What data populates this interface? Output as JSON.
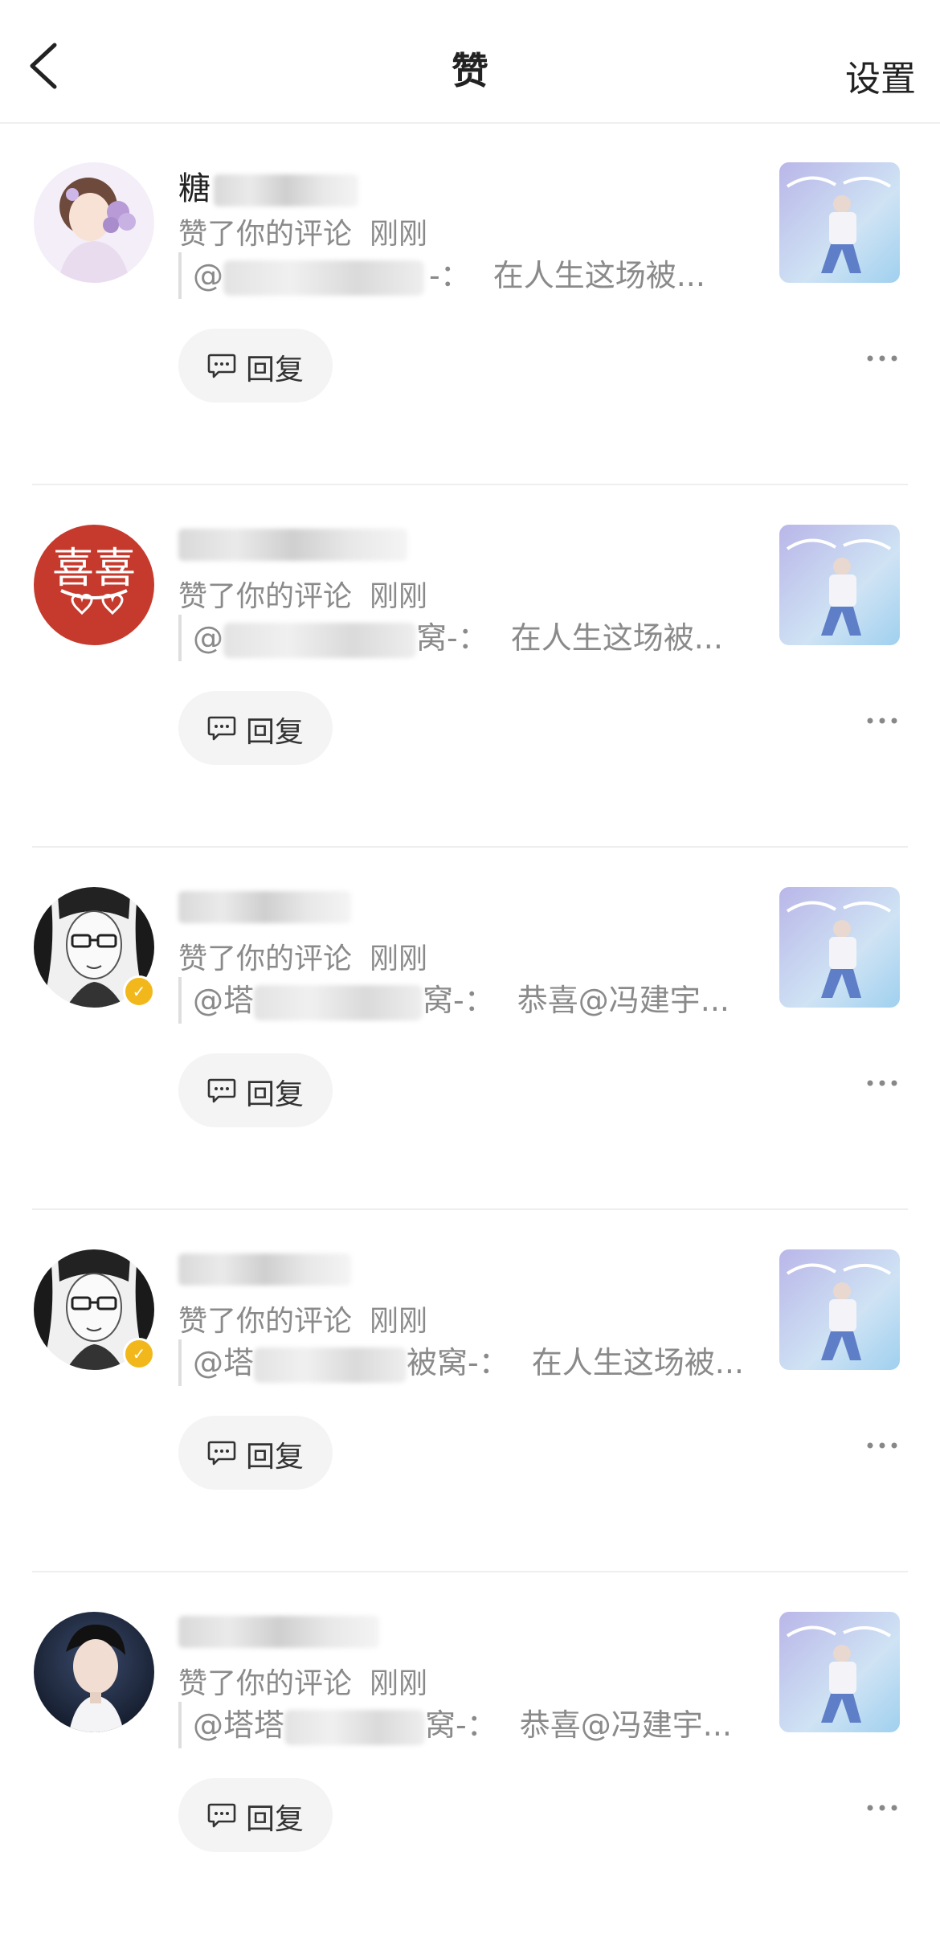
{
  "header": {
    "title": "赞",
    "settings_label": "设置"
  },
  "items": [
    {
      "name_visible": "糖",
      "action": "赞了你的评论",
      "time": "刚刚",
      "quote_prefix": "@",
      "quote_content": "在人生这场被...",
      "reply_label": "回复",
      "avatar": "girl-flowers-avatar",
      "verified": false
    },
    {
      "name_visible": "",
      "action": "赞了你的评论",
      "time": "刚刚",
      "quote_prefix": "@",
      "quote_suffix": "窝-：",
      "quote_content": "在人生这场被...",
      "reply_label": "回复",
      "avatar": "double-happiness-avatar",
      "verified": false
    },
    {
      "name_visible": "",
      "action": "赞了你的评论",
      "time": "刚刚",
      "quote_prefix": "@塔",
      "quote_suffix": "窝-：",
      "quote_content": "恭喜@冯建宇...",
      "reply_label": "回复",
      "avatar": "manga-portrait-avatar",
      "verified": true
    },
    {
      "name_visible": "",
      "action": "赞了你的评论",
      "time": "刚刚",
      "quote_prefix": "@塔",
      "quote_suffix": "被窝-：",
      "quote_content": "在人生这场被...",
      "reply_label": "回复",
      "avatar": "manga-portrait-avatar",
      "verified": true
    },
    {
      "name_visible": "",
      "action": "赞了你的评论",
      "time": "刚刚",
      "quote_prefix": "@塔塔",
      "quote_suffix": "窝-：",
      "quote_content": "恭喜@冯建宇...",
      "reply_label": "回复",
      "avatar": "young-man-photo-avatar",
      "verified": false
    }
  ],
  "colors": {
    "text_primary": "#222222",
    "text_secondary": "#8a8a8a",
    "reply_bg": "#f4f4f4",
    "divider": "#eeeeee",
    "verified_badge": "#f2b81b",
    "double_happiness_red": "#c63a2d"
  }
}
